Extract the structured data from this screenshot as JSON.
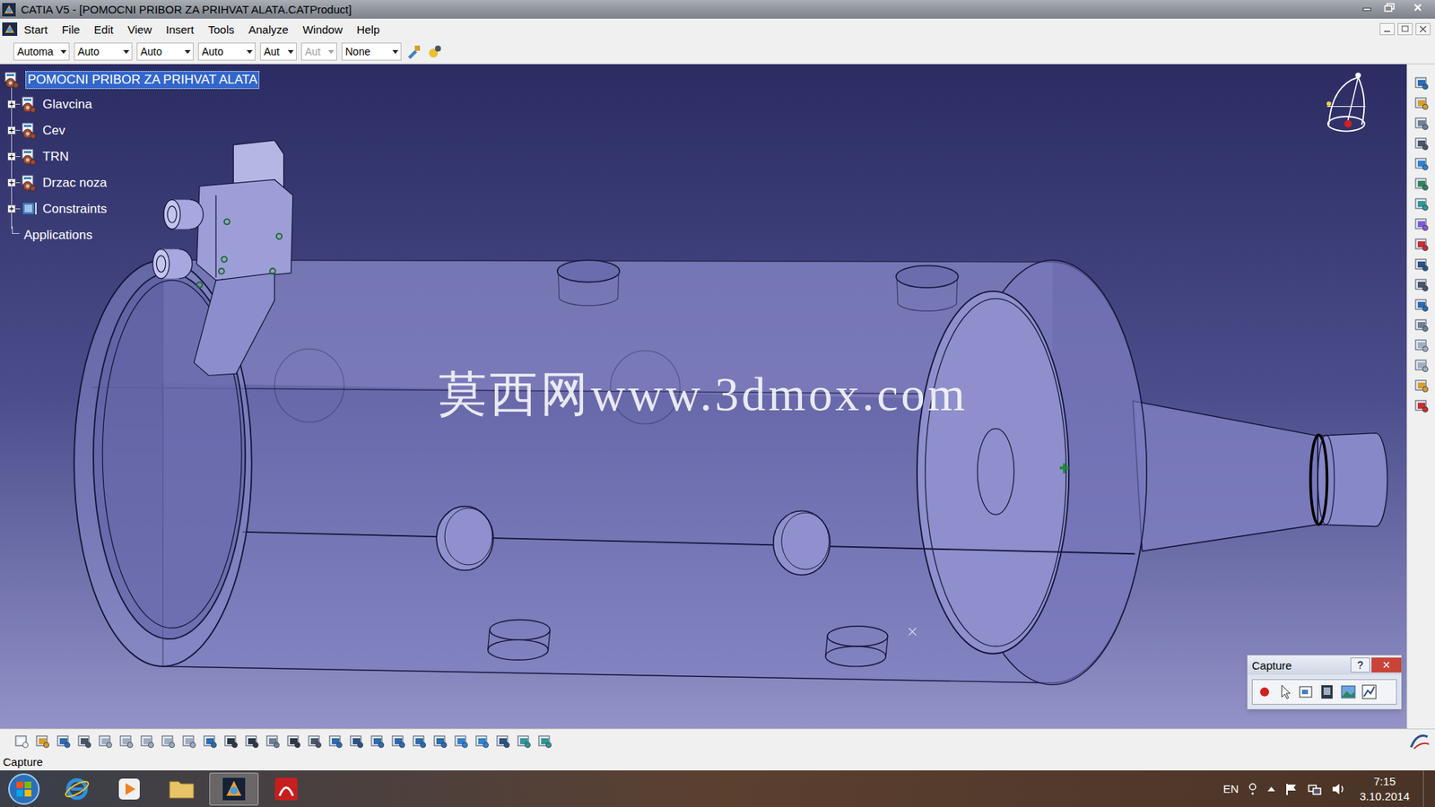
{
  "window": {
    "title": "CATIA V5 - [POMOCNI PRIBOR ZA PRIHVAT ALATA.CATProduct]"
  },
  "menu": [
    "Start",
    "File",
    "Edit",
    "View",
    "Insert",
    "Tools",
    "Analyze",
    "Window",
    "Help"
  ],
  "style_toolbar": [
    {
      "label": "Automa",
      "disabled": false
    },
    {
      "label": "Auto",
      "disabled": false
    },
    {
      "label": "Auto",
      "disabled": false
    },
    {
      "label": "Auto",
      "disabled": false
    },
    {
      "label": "Aut",
      "disabled": false
    },
    {
      "label": "Aut",
      "disabled": true
    },
    {
      "label": "None",
      "disabled": false
    }
  ],
  "tree": {
    "root": {
      "label": "POMOCNI PRIBOR ZA PRIHVAT ALATA",
      "selected": true
    },
    "items": [
      {
        "label": "Glavcina",
        "kind": "component",
        "expanded": false,
        "selected": false
      },
      {
        "label": "Cev",
        "kind": "component",
        "expanded": false,
        "selected": false
      },
      {
        "label": "TRN",
        "kind": "component",
        "expanded": false,
        "selected": false
      },
      {
        "label": "Drzac noza",
        "kind": "component",
        "expanded": false,
        "selected": false
      },
      {
        "label": "Constraints",
        "kind": "constraints",
        "expanded": false,
        "selected": false
      },
      {
        "label": "Applications",
        "kind": "applications",
        "expanded": false,
        "selected": false
      }
    ]
  },
  "watermark": "莫西网www.3dmox.com",
  "capture_toolbar": {
    "title": "Capture",
    "help": "?",
    "close": "×"
  },
  "status_bar": "Capture",
  "taskbar": {
    "language": "EN",
    "time": "7:15",
    "date": "3.10.2014"
  }
}
